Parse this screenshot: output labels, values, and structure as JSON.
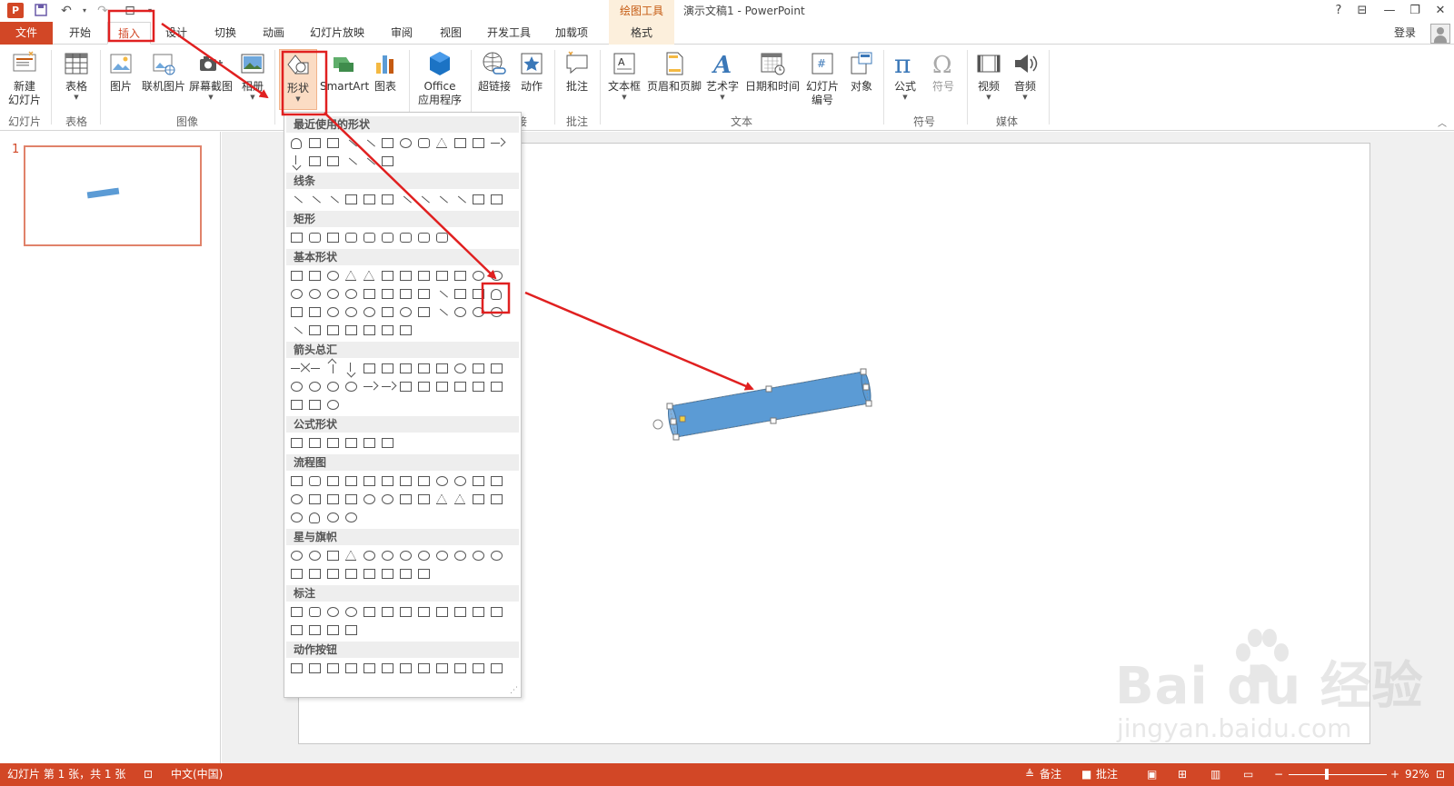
{
  "titlebar": {
    "app_icon": "P",
    "context_tab": "绘图工具",
    "doc_title": "演示文稿1 - PowerPoint",
    "help": "?",
    "min": "—",
    "restore": "❐",
    "close": "✕"
  },
  "tabs": {
    "file": "文件",
    "home": "开始",
    "insert": "插入",
    "design": "设计",
    "transitions": "切换",
    "animations": "动画",
    "slideshow": "幻灯片放映",
    "review": "审阅",
    "view": "视图",
    "developer": "开发工具",
    "addins": "加载项",
    "format": "格式",
    "login": "登录"
  },
  "ribbon": {
    "new_slide": "新建",
    "new_slide_2": "幻灯片",
    "table": "表格",
    "picture": "图片",
    "online_picture": "联机图片",
    "screenshot": "屏幕截图",
    "album": "相册",
    "shapes": "形状",
    "smartart": "SmartArt",
    "chart": "图表",
    "office_apps": "Office",
    "office_apps_2": "应用程序",
    "hyperlink": "超链接",
    "action": "动作",
    "comment": "批注",
    "textbox": "文本框",
    "header_footer": "页眉和页脚",
    "wordart": "艺术字",
    "datetime": "日期和时间",
    "slide_number": "幻灯片",
    "slide_number_2": "编号",
    "object": "对象",
    "equation": "公式",
    "symbol": "符号",
    "video": "视频",
    "audio": "音频",
    "groups": {
      "slides": "幻灯片",
      "tables": "表格",
      "images": "图像",
      "links": "接",
      "comments": "批注",
      "text": "文本",
      "symbols": "符号",
      "media": "媒体"
    }
  },
  "gallery": {
    "recent": "最近使用的形状",
    "lines": "线条",
    "rectangles": "矩形",
    "basic": "基本形状",
    "arrows": "箭头总汇",
    "equation": "公式形状",
    "flowchart": "流程图",
    "stars": "星与旗帜",
    "callouts": "标注",
    "action_buttons": "动作按钮"
  },
  "thumbs": {
    "slide_number": "1"
  },
  "statusbar": {
    "slide_info": "幻灯片 第 1 张，共 1 张",
    "language": "中文(中国)",
    "notes": "备注",
    "comments": "批注",
    "zoom": "92%"
  },
  "watermark": {
    "brand": "Bai du 经验",
    "url": "jingyan.baidu.com"
  },
  "colors": {
    "accent": "#d24726",
    "shape_fill": "#5b9bd5",
    "annotation": "#e02020"
  }
}
